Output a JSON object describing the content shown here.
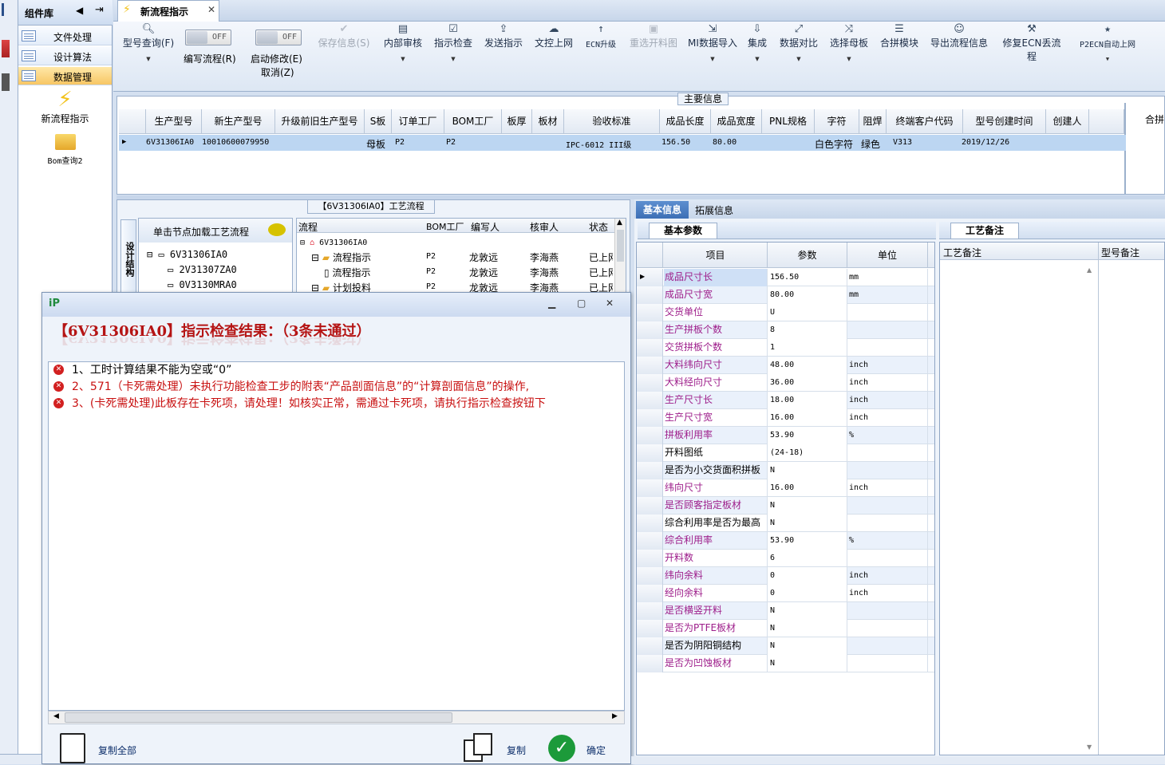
{
  "components": {
    "title": "组件库",
    "items": [
      {
        "label": "文件处理"
      },
      {
        "label": "设计算法"
      },
      {
        "label": "数据管理"
      }
    ],
    "apps": [
      {
        "label": "新流程指示",
        "icon": "lightning-icon"
      },
      {
        "label": "Bom查询2",
        "icon": "folder-icon"
      }
    ]
  },
  "tab": {
    "label": "新流程指示"
  },
  "toolbar": {
    "model_query": "型号查询(F)",
    "edit_flow": "编写流程(R)",
    "start_modify": "启动修改(E)",
    "cancel": "取消(Z)",
    "off": "OFF",
    "buttons": [
      {
        "label": "保存信息(S)",
        "icon": "check-icon"
      },
      {
        "label": "内部审核",
        "icon": "printer-icon"
      },
      {
        "label": "指示检查",
        "icon": "checkbox-icon"
      },
      {
        "label": "发送指示",
        "icon": "upload-tray-icon"
      },
      {
        "label": "文控上网",
        "icon": "cloud-upload-icon"
      },
      {
        "label": "ECN升级",
        "icon": "arrow-up-icon"
      },
      {
        "label": "重选开料图",
        "icon": "image-icon"
      },
      {
        "label": "MI数据导入",
        "icon": "import-icon"
      },
      {
        "label": "集成",
        "icon": "download-tray-icon"
      },
      {
        "label": "数据对比",
        "icon": "compare-icon"
      },
      {
        "label": "选择母板",
        "icon": "shuffle-icon"
      },
      {
        "label": "合拼模块",
        "icon": "list-icon"
      },
      {
        "label": "导出流程信息",
        "icon": "smile-icon"
      },
      {
        "label": "修复ECN丢流程",
        "icon": "wrench-icon"
      },
      {
        "label": "P2ECN自动上网",
        "icon": "star-icon"
      }
    ]
  },
  "main_info": {
    "title": "主要信息",
    "columns": [
      "生产型号",
      "新生产型号",
      "升级前旧生产型号",
      "S板",
      "订单工厂",
      "BOM工厂",
      "板厚",
      "板材",
      "验收标准",
      "成品长度",
      "成品宽度",
      "PNL规格",
      "字符",
      "阻焊",
      "终端客户代码",
      "型号创建时间",
      "创建人"
    ],
    "row": [
      "6V31306IA0",
      "10010600079950",
      "",
      "母板",
      "P2",
      "P2",
      "",
      "",
      "IPC-6012 III级",
      "156.50",
      "80.00",
      "",
      "白色字符",
      "绿色",
      "V313",
      "2019/12/26",
      ""
    ],
    "side_header": "合拼"
  },
  "process": {
    "title": "【6V31306IA0】工艺流程",
    "side_tab": "设计结构",
    "hint": "单击节点加载工艺流程",
    "tree": [
      "6V31306IA0",
      "2V31307ZA0",
      "0V3130MRA0"
    ],
    "columns": [
      "流程",
      "BOM工厂",
      "编写人",
      "核审人",
      "状态"
    ],
    "rows": [
      {
        "name": "6V31306IA0",
        "bom": "",
        "writer": "",
        "checker": "",
        "status": ""
      },
      {
        "name": "流程指示",
        "bom": "P2",
        "writer": "龙敦远",
        "checker": "李海燕",
        "status": "已上网"
      },
      {
        "name": "流程指示",
        "bom": "P2",
        "writer": "龙敦远",
        "checker": "李海燕",
        "status": "已上网"
      },
      {
        "name": "计划投料",
        "bom": "P2",
        "writer": "龙敦远",
        "checker": "李海燕",
        "status": "已上网"
      }
    ]
  },
  "info_tabs": [
    "基本信息",
    "拓展信息"
  ],
  "basic": {
    "title": "基本参数",
    "columns": [
      "项目",
      "参数",
      "单位"
    ],
    "rows": [
      {
        "name": "成品尺寸长",
        "value": "156.50",
        "unit": "mm",
        "pink": true
      },
      {
        "name": "成品尺寸宽",
        "value": "80.00",
        "unit": "mm",
        "pink": true
      },
      {
        "name": "交货单位",
        "value": "U",
        "unit": "",
        "pink": true
      },
      {
        "name": "生产拼板个数",
        "value": "8",
        "unit": "",
        "pink": true
      },
      {
        "name": "交货拼板个数",
        "value": "1",
        "unit": "",
        "pink": true
      },
      {
        "name": "大料纬向尺寸",
        "value": "48.00",
        "unit": "inch",
        "pink": true
      },
      {
        "name": "大料经向尺寸",
        "value": "36.00",
        "unit": "inch",
        "pink": true
      },
      {
        "name": "生产尺寸长",
        "value": "18.00",
        "unit": "inch",
        "pink": true
      },
      {
        "name": "生产尺寸宽",
        "value": "16.00",
        "unit": "inch",
        "pink": true
      },
      {
        "name": "拼板利用率",
        "value": "53.90",
        "unit": "%",
        "pink": true
      },
      {
        "name": "开料图纸",
        "value": "(24-18)",
        "unit": "",
        "pink": false
      },
      {
        "name": "是否为小交货面积拼板",
        "value": "N",
        "unit": "",
        "pink": false
      },
      {
        "name": "纬向尺寸",
        "value": "16.00",
        "unit": "inch",
        "pink": true
      },
      {
        "name": "是否顾客指定板材",
        "value": "N",
        "unit": "",
        "pink": true
      },
      {
        "name": "综合利用率是否为最高",
        "value": "N",
        "unit": "",
        "pink": false
      },
      {
        "name": "综合利用率",
        "value": "53.90",
        "unit": "%",
        "pink": true
      },
      {
        "name": "开料数",
        "value": "6",
        "unit": "",
        "pink": true
      },
      {
        "name": "纬向余料",
        "value": "0",
        "unit": "inch",
        "pink": true
      },
      {
        "name": "经向余料",
        "value": "0",
        "unit": "inch",
        "pink": true
      },
      {
        "name": "是否横竖开料",
        "value": "N",
        "unit": "",
        "pink": true
      },
      {
        "name": "是否为PTFE板材",
        "value": "N",
        "unit": "",
        "pink": true
      },
      {
        "name": "是否为阴阳铜结构",
        "value": "N",
        "unit": "",
        "pink": false
      },
      {
        "name": "是否为凹蚀板材",
        "value": "N",
        "unit": "",
        "pink": true
      }
    ]
  },
  "notes": {
    "title": "工艺备注",
    "col1": "工艺备注",
    "col2": "型号备注"
  },
  "dialog": {
    "title": "【6V31306IA0】指示检查结果：（3条未通过）",
    "errors": [
      "1、工时计算结果不能为空或“0”",
      "2、571（卡死需处理）未执行功能检查工步的附表“产品剖面信息”的“计算剖面信息”的操作,",
      "3、(卡死需处理)此板存在卡死项，请处理！如核实正常，需通过卡死项，请执行指示检查按钮下"
    ],
    "copy_all": "复制全部",
    "copy": "复制",
    "ok": "确定"
  }
}
